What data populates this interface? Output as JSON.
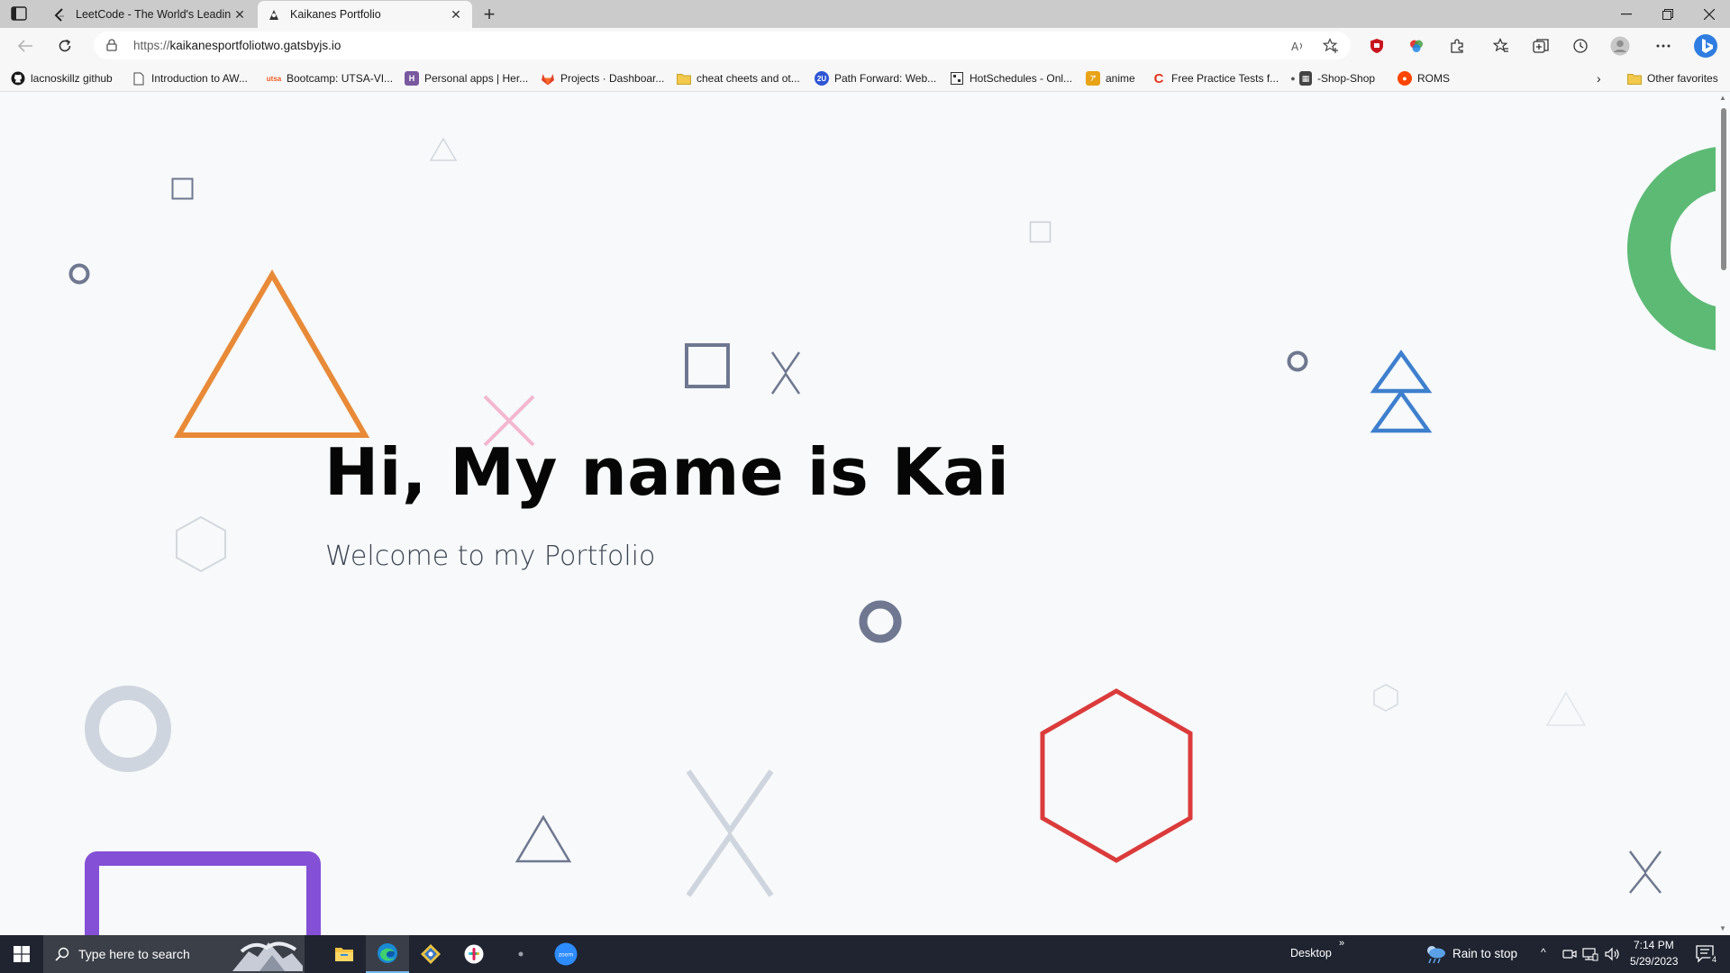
{
  "browser": {
    "tabs": [
      {
        "title": "LeetCode - The World's Leading",
        "active": false,
        "favicon": "leetcode-icon"
      },
      {
        "title": "Kaikanes Portfolio",
        "active": true,
        "favicon": "gatsby-icon"
      }
    ],
    "address": {
      "protocol": "https://",
      "host": "kaikanesportfoliotwo.gatsbyjs.io"
    },
    "favorites": [
      {
        "label": "lacnoskillz github",
        "icon": "github-icon"
      },
      {
        "label": "Introduction to AW...",
        "icon": "page-icon"
      },
      {
        "label": "Bootcamp: UTSA-VI...",
        "icon": "utsa-icon"
      },
      {
        "label": "Personal apps | Her...",
        "icon": "heroku-icon"
      },
      {
        "label": "Projects · Dashboar...",
        "icon": "gitlab-icon"
      },
      {
        "label": "cheat cheets and ot...",
        "icon": "folder-icon"
      },
      {
        "label": "Path Forward: Web...",
        "icon": "2u-icon"
      },
      {
        "label": "HotSchedules - Onl...",
        "icon": "hotschedules-icon"
      },
      {
        "label": "anime",
        "icon": "anime-icon"
      },
      {
        "label": "Free Practice Tests f...",
        "icon": "practice-tests-icon"
      },
      {
        "label": "-Shop-Shop",
        "icon": "shop-icon"
      },
      {
        "label": "ROMS",
        "icon": "reddit-icon"
      }
    ],
    "other_favorites": "Other favorites"
  },
  "page": {
    "title": "Hi, My name is Kai",
    "subtitle": "Welcome to my Portfolio"
  },
  "taskbar": {
    "search_placeholder": "Type here to search",
    "desktop_label": "Desktop",
    "weather": "Rain to stop",
    "time": "7:14 PM",
    "date": "5/29/2023",
    "notification_count": "4"
  },
  "colors": {
    "orange": "#e88a37",
    "green": "#5cba75",
    "blue": "#3e7fce",
    "red": "#db3b3b",
    "purple": "#8450d6",
    "pink": "#f3b7cf",
    "slate": "#6f7890",
    "light": "#cfd5de"
  }
}
